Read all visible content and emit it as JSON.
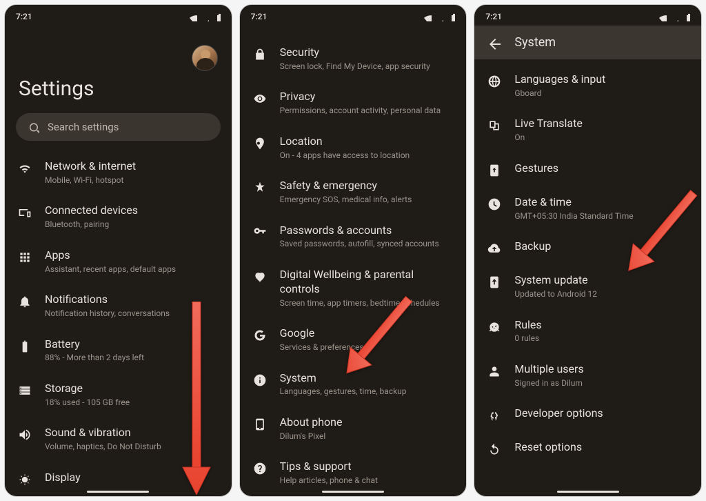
{
  "status": {
    "time": "7:21"
  },
  "screen1": {
    "title": "Settings",
    "search_placeholder": "Search settings",
    "items": [
      {
        "icon": "wifi",
        "title": "Network & internet",
        "sub": "Mobile, Wi-Fi, hotspot"
      },
      {
        "icon": "devices",
        "title": "Connected devices",
        "sub": "Bluetooth, pairing"
      },
      {
        "icon": "apps",
        "title": "Apps",
        "sub": "Assistant, recent apps, default apps"
      },
      {
        "icon": "notifications",
        "title": "Notifications",
        "sub": "Notification history, conversations"
      },
      {
        "icon": "battery",
        "title": "Battery",
        "sub": "88% - More than 2 days left"
      },
      {
        "icon": "storage",
        "title": "Storage",
        "sub": "18% used - 105 GB free"
      },
      {
        "icon": "sound",
        "title": "Sound & vibration",
        "sub": "Volume, haptics, Do Not Disturb"
      },
      {
        "icon": "display",
        "title": "Display",
        "sub": ""
      }
    ]
  },
  "screen2": {
    "items": [
      {
        "icon": "lock",
        "title": "Security",
        "sub": "Screen lock, Find My Device, app security"
      },
      {
        "icon": "privacy",
        "title": "Privacy",
        "sub": "Permissions, account activity, personal data"
      },
      {
        "icon": "location",
        "title": "Location",
        "sub": "On - 4 apps have access to location"
      },
      {
        "icon": "emergency",
        "title": "Safety & emergency",
        "sub": "Emergency SOS, medical info, alerts"
      },
      {
        "icon": "key",
        "title": "Passwords & accounts",
        "sub": "Saved passwords, autofill, synced accounts"
      },
      {
        "icon": "wellbeing",
        "title": "Digital Wellbeing & parental controls",
        "sub": "Screen time, app timers, bedtime schedules"
      },
      {
        "icon": "google",
        "title": "Google",
        "sub": "Services & preferences"
      },
      {
        "icon": "info",
        "title": "System",
        "sub": "Languages, gestures, time, backup"
      },
      {
        "icon": "phone",
        "title": "About phone",
        "sub": "Dilum's Pixel"
      },
      {
        "icon": "tips",
        "title": "Tips & support",
        "sub": "Help articles, phone & chat"
      }
    ]
  },
  "screen3": {
    "appbar": "System",
    "items": [
      {
        "icon": "language",
        "title": "Languages & input",
        "sub": "Gboard"
      },
      {
        "icon": "translate",
        "title": "Live Translate",
        "sub": "On"
      },
      {
        "icon": "gestures",
        "title": "Gestures",
        "sub": ""
      },
      {
        "icon": "clock",
        "title": "Date & time",
        "sub": "GMT+05:30 India Standard Time"
      },
      {
        "icon": "backup",
        "title": "Backup",
        "sub": ""
      },
      {
        "icon": "sysupdate",
        "title": "System update",
        "sub": "Updated to Android 12"
      },
      {
        "icon": "rules",
        "title": "Rules",
        "sub": "0 rules"
      },
      {
        "icon": "multiuser",
        "title": "Multiple users",
        "sub": "Signed in as Dilum"
      },
      {
        "icon": "devopt",
        "title": "Developer options",
        "sub": ""
      },
      {
        "icon": "reset",
        "title": "Reset options",
        "sub": ""
      }
    ]
  }
}
